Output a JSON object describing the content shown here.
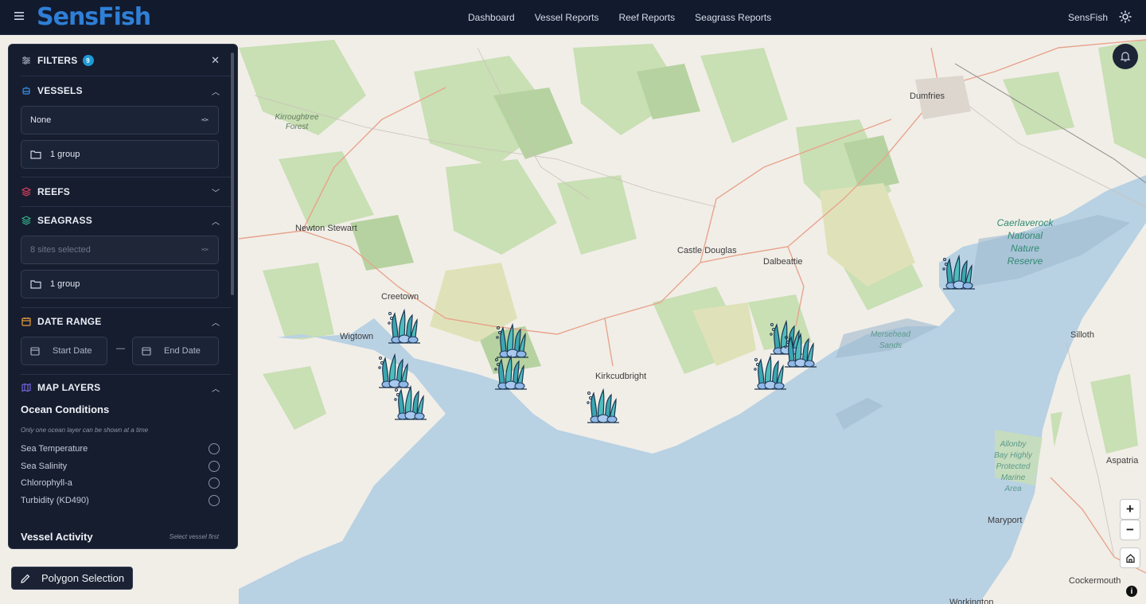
{
  "app": {
    "logo": "SensFish",
    "user": "SensFish"
  },
  "nav": [
    "Dashboard",
    "Vessel Reports",
    "Reef Reports",
    "Seagrass Reports"
  ],
  "filters": {
    "title": "FILTERS",
    "badge": "9",
    "vessels": {
      "title": "VESSELS",
      "select_value": "None",
      "group": "1 group"
    },
    "reefs": {
      "title": "REEFS"
    },
    "seagrass": {
      "title": "SEAGRASS",
      "select_placeholder": "8 sites selected",
      "group": "1 group"
    },
    "date_range": {
      "title": "DATE RANGE",
      "start": "Start Date",
      "end": "End Date",
      "separator": "—"
    },
    "map_layers": {
      "title": "MAP LAYERS",
      "ocean_title": "Ocean Conditions",
      "ocean_note": "Only one ocean layer can be shown at a time",
      "layers": [
        "Sea Temperature",
        "Sea Salinity",
        "Chlorophyll-a",
        "Turbidity (KD490)"
      ],
      "vessel_activity": "Vessel Activity",
      "vessel_note": "Select vessel first"
    }
  },
  "map": {
    "places": {
      "dumfries": "Dumfries",
      "newton_stewart": "Newton Stewart",
      "castle_douglas": "Castle Douglas",
      "dalbeattie": "Dalbeattie",
      "creetown": "Creetown",
      "wigtown": "Wigtown",
      "kirkcudbright": "Kirkcudbright",
      "silloth": "Silloth",
      "aspatria": "Aspatria",
      "maryport": "Maryport",
      "cockermouth": "Cockermouth",
      "workington": "Workington"
    },
    "forest_l1": "Kirroughtree",
    "forest_l2": "Forest",
    "park_l1": "Caerlaverock",
    "park_l2": "National",
    "park_l3": "Nature",
    "park_l4": "Reserve",
    "sands_l1": "Mersehead",
    "sands_l2": "Sands",
    "mpa_l1": "Allonby",
    "mpa_l2": "Bay Highly",
    "mpa_l3": "Protected",
    "mpa_l4": "Marine",
    "mpa_l5": "Area"
  },
  "controls": {
    "zoom_in": "+",
    "zoom_out": "−",
    "info": "i",
    "polygon": "Polygon Selection"
  },
  "icons": [
    "menu-icon",
    "sun-icon",
    "bell-icon",
    "filter-icon",
    "close-icon",
    "vessel-icon",
    "reef-icon",
    "seagrass-icon",
    "calendar-icon",
    "map-layers-icon",
    "folder-icon",
    "home-icon",
    "pencil-icon",
    "seagrass-marker-icon"
  ],
  "colors": {
    "nav_bg": "#121a2e",
    "panel_bg": "#161d2f",
    "brand": "#2f7fd6",
    "badge": "#1e9bd7",
    "reef": "#e0405e",
    "seagrass": "#35b58c",
    "date": "#e8a23a",
    "layers": "#7b6ae6"
  }
}
